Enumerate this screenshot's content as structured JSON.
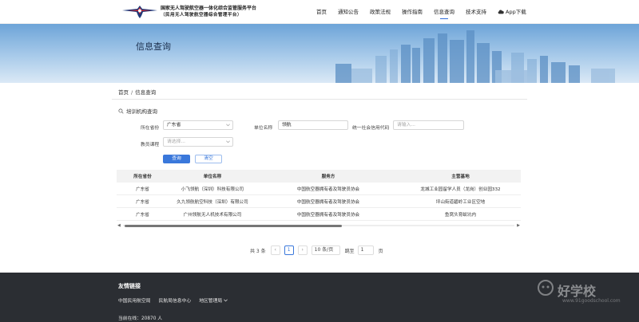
{
  "header": {
    "org_line1": "国家无人驾驶航空器一体化综合监管服务平台",
    "org_line2": "（民用无人驾驶航空器综合管理平台）",
    "nav": [
      {
        "label": "首页",
        "active": false
      },
      {
        "label": "通知公告",
        "active": false
      },
      {
        "label": "政策法规",
        "active": false
      },
      {
        "label": "操作指南",
        "active": false
      },
      {
        "label": "信息查询",
        "active": true
      },
      {
        "label": "技术支持",
        "active": false
      }
    ],
    "app_download": "App下载"
  },
  "banner": {
    "title": "信息查询"
  },
  "breadcrumb": {
    "home": "首页",
    "sep": "/",
    "current": "信息查询"
  },
  "query": {
    "section_title": "培训机构查询",
    "province_label": "所在省份",
    "province_value": "广东省",
    "unit_label": "单位名称",
    "unit_value": "领航",
    "credit_label": "统一社会信用代码",
    "credit_placeholder": "请输入...",
    "course_label": "教员课程",
    "course_placeholder": "请选择...",
    "search_button": "查询",
    "clear_button": "清空"
  },
  "table": {
    "columns": [
      "所在省份",
      "单位名称",
      "服务方",
      "主营基地"
    ],
    "rows": [
      [
        "广东省",
        "小飞领航（深圳）科技有限公司",
        "中国航空器拥有者及驾驶员协会",
        "龙城工业园留学人员（龙岗）创业园332"
      ],
      [
        "广东省",
        "久九领航航空科技（深圳）有限公司",
        "中国航空器拥有者及驾驶员协会",
        "坪山街道碧岭工业区空地"
      ],
      [
        "广东省",
        "广州领航无人机技术有限公司",
        "中国航空器拥有者及驾驶员协会",
        "鱼窝头育蚁坑内"
      ]
    ]
  },
  "pagination": {
    "total": "共 3 条",
    "current_page": "1",
    "page_size": "10 条/页",
    "jump_label": "跳至",
    "jump_value": "1",
    "page_unit": "页"
  },
  "footer": {
    "title": "友情链接",
    "links": [
      "中国民用航空局",
      "民航局信息中心",
      "地区管理局"
    ],
    "online": "当前在线：20870 人"
  },
  "watermark": {
    "text": "好学校",
    "url": "www.91goodschool.com"
  },
  "colors": {
    "accent": "#3a78db",
    "footer_bg": "#2b2e33",
    "nav_active": "#2f6bd8"
  },
  "icons": {
    "search": "search-icon",
    "cloud": "cloud-download-icon",
    "chevron": "chevron-down-icon"
  }
}
